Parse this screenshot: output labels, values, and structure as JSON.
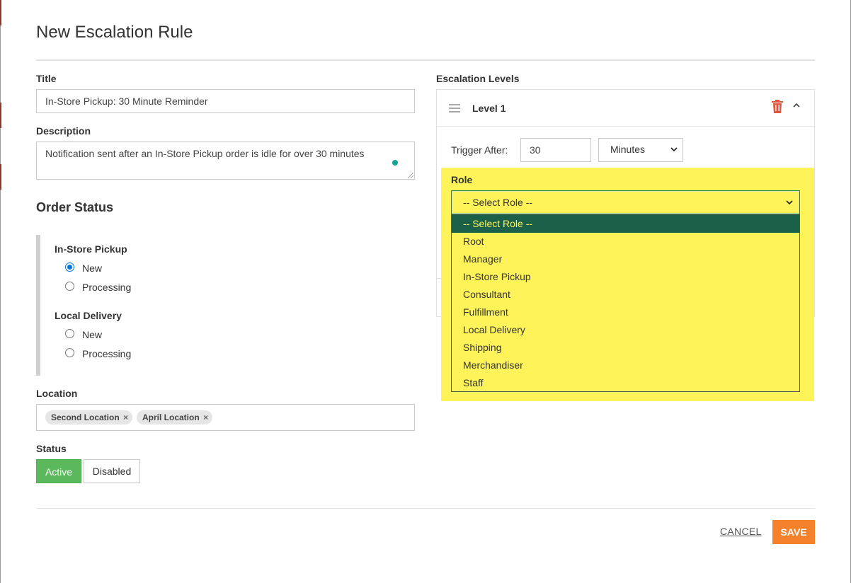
{
  "modal": {
    "title": "New Escalation Rule"
  },
  "form": {
    "title_label": "Title",
    "title_value": "In-Store Pickup: 30 Minute Reminder",
    "description_label": "Description",
    "description_value": "Notification sent after an In-Store Pickup order is idle for over 30 minutes"
  },
  "order_status": {
    "heading": "Order Status",
    "groups": [
      {
        "title": "In-Store Pickup",
        "options": [
          {
            "label": "New",
            "checked": true
          },
          {
            "label": "Processing",
            "checked": false
          }
        ]
      },
      {
        "title": "Local Delivery",
        "options": [
          {
            "label": "New",
            "checked": false
          },
          {
            "label": "Processing",
            "checked": false
          }
        ]
      }
    ]
  },
  "location": {
    "label": "Location",
    "tags": [
      {
        "label": "Second Location",
        "remove": "×"
      },
      {
        "label": "April Location",
        "remove": "×"
      }
    ]
  },
  "status": {
    "label": "Status",
    "active_label": "Active",
    "disabled_label": "Disabled",
    "selected": "Active"
  },
  "escalation": {
    "label": "Escalation Levels",
    "level_title": "Level 1",
    "trigger_label": "Trigger After:",
    "trigger_value": "30",
    "unit_value": "Minutes",
    "role_label": "Role",
    "role_value": "-- Select Role --",
    "role_options": [
      "-- Select Role --",
      "Root",
      "Manager",
      "In-Store Pickup",
      "Consultant",
      "Fulfillment",
      "Local Delivery",
      "Shipping",
      "Merchandiser",
      "Staff"
    ]
  },
  "footer": {
    "cancel_label": "CANCEL",
    "save_label": "SAVE"
  },
  "icons": {
    "drag": "drag-handle-icon",
    "trash": "trash-icon",
    "collapse": "chevron-up-icon",
    "select_caret": "chevron-down-icon",
    "remove_tag": "close-icon"
  },
  "colors": {
    "accent": "#f5822a",
    "active": "#5cb85c",
    "highlight": "#fef45a",
    "selected_option": "#1b6049",
    "delete": "#e0533c"
  }
}
